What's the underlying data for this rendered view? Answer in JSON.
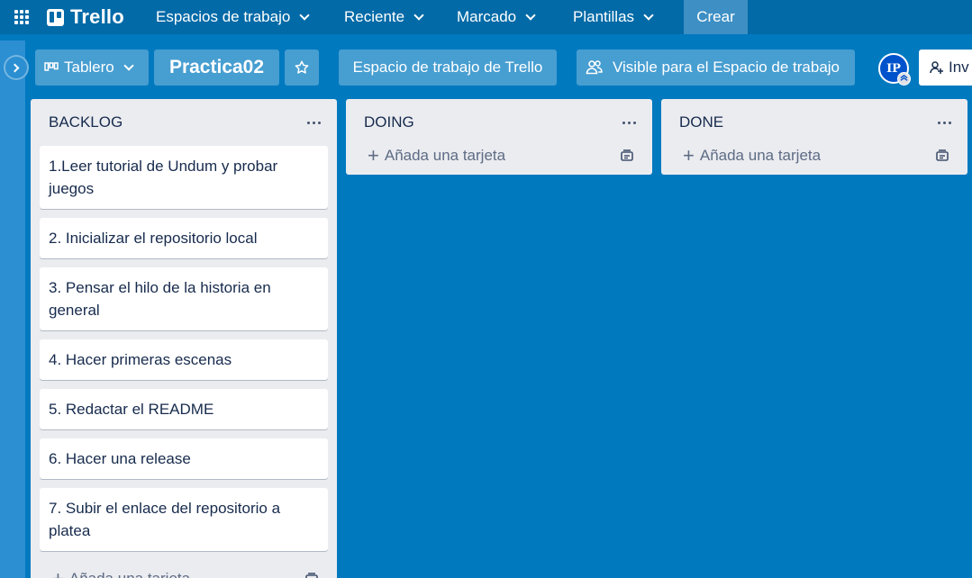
{
  "header": {
    "logo_text": "Trello",
    "nav": [
      {
        "label": "Espacios de trabajo"
      },
      {
        "label": "Reciente"
      },
      {
        "label": "Marcado"
      },
      {
        "label": "Plantillas"
      }
    ],
    "create_label": "Crear"
  },
  "board": {
    "view_label": "Tablero",
    "title": "Practica02",
    "workspace_label": "Espacio de trabajo de Trello",
    "visibility_label": "Visible para el Espacio de trabajo",
    "avatar_initials": "IP",
    "invite_label": "Inv"
  },
  "lists": [
    {
      "title": "BACKLOG",
      "cards": [
        "1.Leer tutorial de Undum y probar juegos",
        "2. Inicializar el repositorio local",
        "3. Pensar el hilo de la historia en general",
        "4. Hacer primeras escenas",
        "5. Redactar el README",
        "6. Hacer una release",
        "7. Subir el enlace del repositorio a platea"
      ],
      "add_label": "Añada una tarjeta"
    },
    {
      "title": "DOING",
      "cards": [],
      "add_label": "Añada una tarjeta"
    },
    {
      "title": "DONE",
      "cards": [],
      "add_label": "Añada una tarjeta"
    }
  ],
  "colors": {
    "board_bg": "#0079bf",
    "header_bg": "#026aa7",
    "list_bg": "#ebecf0",
    "avatar_bg": "#0052cc"
  }
}
